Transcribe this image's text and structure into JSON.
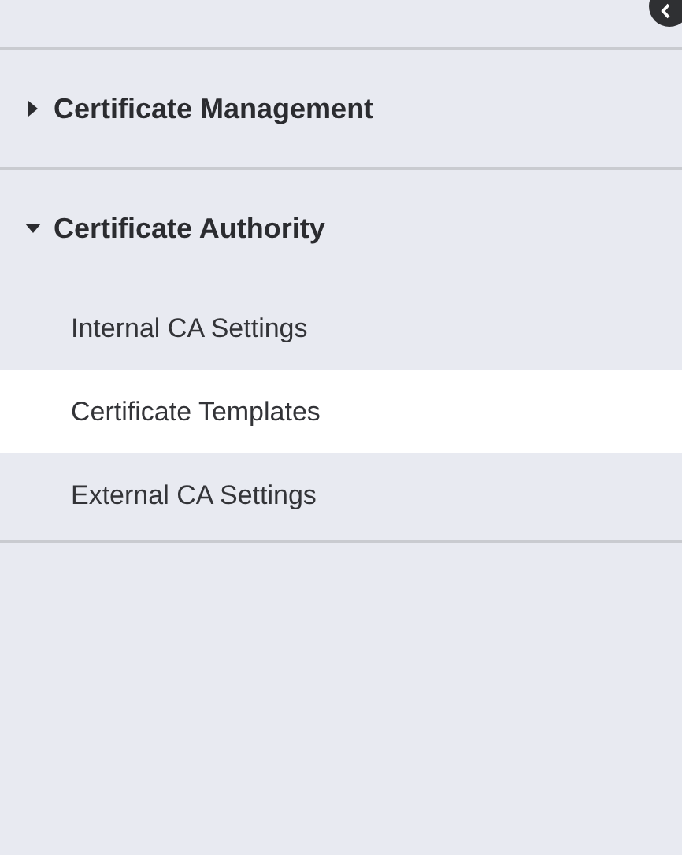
{
  "sections": [
    {
      "title": "Certificate Management",
      "expanded": false
    },
    {
      "title": "Certificate Authority",
      "expanded": true,
      "items": [
        {
          "label": "Internal CA Settings",
          "selected": false
        },
        {
          "label": "Certificate Templates",
          "selected": true
        },
        {
          "label": "External CA Settings",
          "selected": false
        }
      ]
    }
  ]
}
